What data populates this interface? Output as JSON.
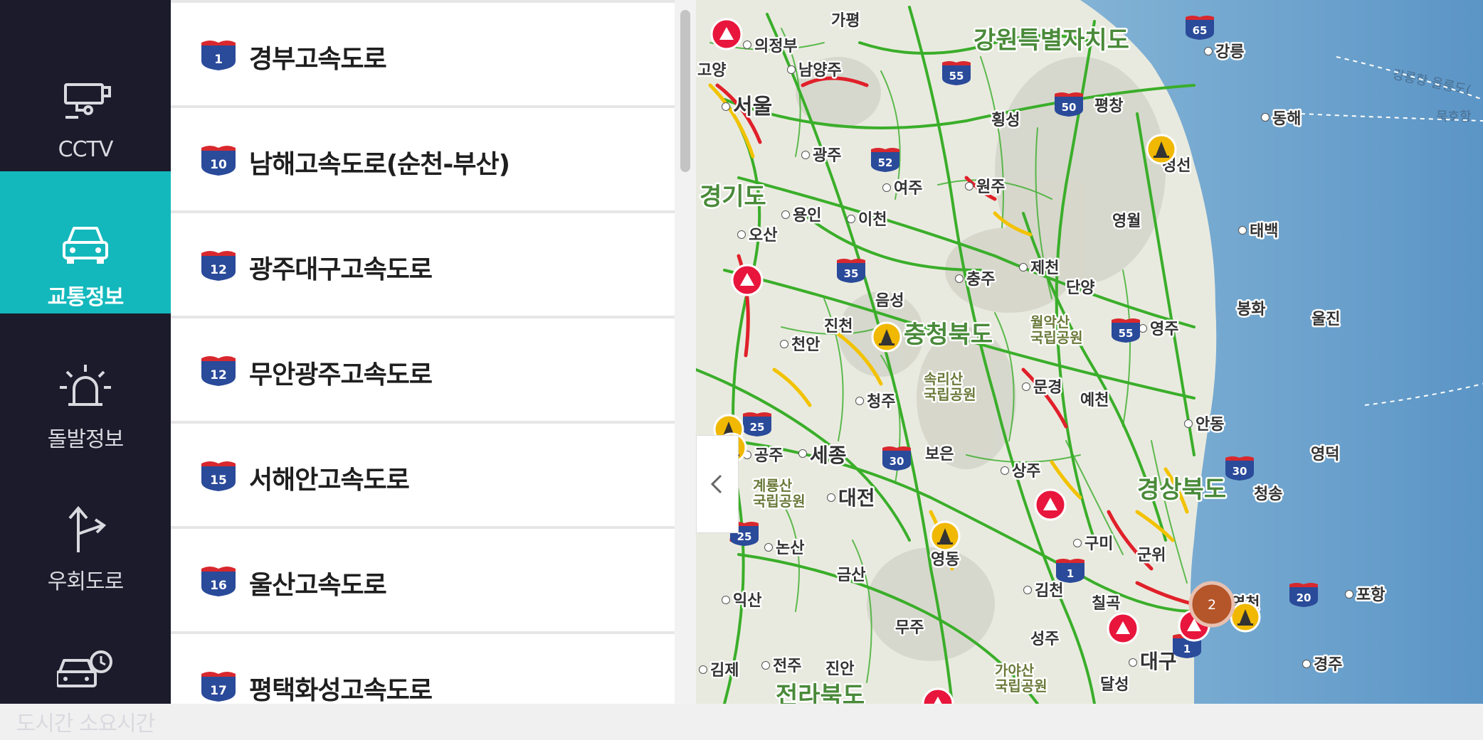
{
  "nav": {
    "items": [
      {
        "label": "CCTV",
        "icon": "cctv-icon",
        "active": false
      },
      {
        "label": "교통정보",
        "icon": "car-icon",
        "active": true
      },
      {
        "label": "돌발정보",
        "icon": "siren-icon",
        "active": false
      },
      {
        "label": "우회도로",
        "icon": "detour-arrow-icon",
        "active": false
      },
      {
        "label": "도시간 소요시간",
        "icon": "car-clock-icon",
        "active": false
      }
    ]
  },
  "roads": [
    {
      "number": "1",
      "name": "경부고속도로"
    },
    {
      "number": "10",
      "name": "남해고속도로(순천-부산)"
    },
    {
      "number": "12",
      "name": "광주대구고속도로"
    },
    {
      "number": "12",
      "name": "무안광주고속도로"
    },
    {
      "number": "15",
      "name": "서해안고속도로"
    },
    {
      "number": "16",
      "name": "울산고속도로"
    },
    {
      "number": "17",
      "name": "평택화성고속도로"
    }
  ],
  "map": {
    "provinces": [
      "강원특별자치도",
      "경기도",
      "충청북도",
      "경상북도",
      "전라북도"
    ],
    "cities": [
      "가평",
      "의정부",
      "남양주",
      "고양",
      "서울",
      "광주",
      "여주",
      "원주",
      "횡성",
      "평창",
      "강릉",
      "동해",
      "정선",
      "영월",
      "태백",
      "용인",
      "이천",
      "오산",
      "충주",
      "제천",
      "단양",
      "음성",
      "진천",
      "천안",
      "영주",
      "봉화",
      "울진",
      "청주",
      "문경",
      "예천",
      "안동",
      "공주",
      "세종",
      "보은",
      "상주",
      "영덕",
      "대전",
      "청송",
      "논산",
      "영동",
      "구미",
      "군위",
      "포항",
      "익산",
      "금산",
      "김천",
      "칠곡",
      "영천",
      "김제",
      "전주",
      "진안",
      "무주",
      "성주",
      "대구",
      "달성",
      "경주"
    ],
    "parks": [
      "월악산 국립공원",
      "속리산 국립공원",
      "계룡산 국립공원",
      "가야산 국립공원"
    ],
    "sea_labels": [
      "강릉항 울릉도(",
      "묵호항"
    ],
    "route_shields": [
      "65",
      "55",
      "50",
      "52",
      "35",
      "55",
      "25",
      "30",
      "30",
      "25",
      "1",
      "20",
      "1"
    ],
    "cluster_count": "2",
    "colors": {
      "smooth": "#3aae2a",
      "slow": "#f2c200",
      "congested": "#e0202a",
      "accident": "#e8163c",
      "construction": "#f0b800",
      "cluster": "#b5552a"
    }
  },
  "collapse_button": "<"
}
